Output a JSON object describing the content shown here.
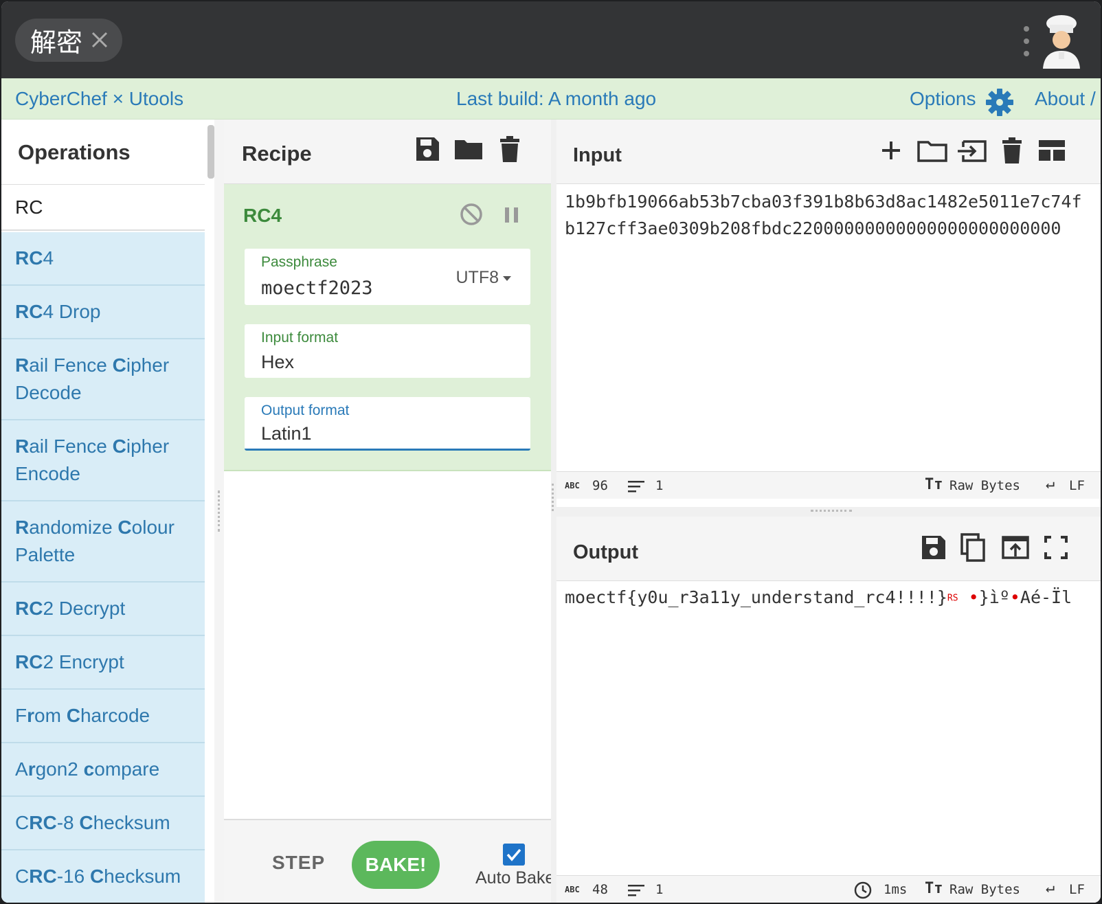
{
  "topbar": {
    "tab_label": "解密"
  },
  "banner": {
    "brand": "CyberChef × Utools",
    "build": "Last build: A month ago",
    "options": "Options",
    "about": "About /"
  },
  "operations": {
    "title": "Operations",
    "search_value": "RC",
    "items": [
      {
        "html": "<b>RC</b>4"
      },
      {
        "html": "<b>RC</b>4 Drop"
      },
      {
        "html": "<b>R</b>ail Fence <b>C</b>ipher Decode"
      },
      {
        "html": "<b>R</b>ail Fence <b>C</b>ipher Encode"
      },
      {
        "html": "<b>R</b>andomize <b>C</b>olour Palette"
      },
      {
        "html": "<b>RC</b>2 Decrypt"
      },
      {
        "html": "<b>RC</b>2 Encrypt"
      },
      {
        "html": "F<b>r</b>om <b>C</b>harcode"
      },
      {
        "html": "A<b>r</b>gon2 <b>c</b>ompare"
      },
      {
        "html": "C<b>RC</b>-8 <b>C</b>hecksum"
      },
      {
        "html": "C<b>RC</b>-16 <b>C</b>hecksum"
      }
    ]
  },
  "recipe": {
    "title": "Recipe",
    "operation_name": "RC4",
    "passphrase_label": "Passphrase",
    "passphrase_value": "moectf2023",
    "passphrase_encoding": "UTF8",
    "input_format_label": "Input format",
    "input_format_value": "Hex",
    "output_format_label": "Output format",
    "output_format_value": "Latin1",
    "step_label": "STEP",
    "bake_label": "BAKE!",
    "auto_bake_label": "Auto Bake",
    "auto_bake_checked": true
  },
  "input": {
    "title": "Input",
    "line1": "1b9bfb19066ab53b7cba03f391b8b63d8ac1482e5011e7c74f",
    "line2": "b127cff3ae0309b208fbdc22000000000000000000000000",
    "length": "96",
    "lines": "1",
    "encoding": "Raw Bytes",
    "eol": "LF"
  },
  "output": {
    "title": "Output",
    "text_main": "moectf{y0u_r3a11y_understand_rc4!!!!}",
    "ctrl_rs": "RS",
    "text_tail_1": "}ìº",
    "text_tail_2": "Aé-Ïl",
    "length": "48",
    "lines": "1",
    "time": "1ms",
    "encoding": "Raw Bytes",
    "eol": "LF"
  }
}
